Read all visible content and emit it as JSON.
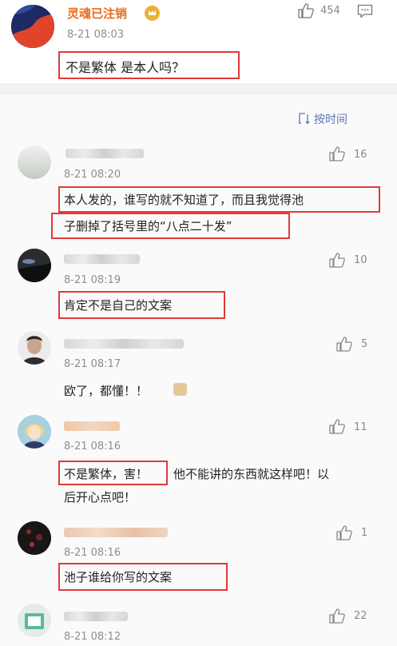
{
  "top": {
    "username": "灵魂已注销",
    "time": "8-21 08:03",
    "likes": "454",
    "text": "不是繁体 是本人吗？"
  },
  "sort_label": "按时间",
  "comments": [
    {
      "time": "8-21 08:20",
      "likes": "16",
      "line1": "本人发的，谁写的就不知道了，而且我觉得池",
      "line2": "子删掉了括号里的“八点二十发”"
    },
    {
      "time": "8-21 08:19",
      "likes": "10",
      "text": "肯定不是自己的文案"
    },
    {
      "time": "8-21 08:17",
      "likes": "5",
      "text": "欧了，都懂！！"
    },
    {
      "time": "8-21 08:16",
      "likes": "11",
      "boxed": "不是繁体，害！",
      "rest1": "他不能讲的东西就这样吧！以",
      "line2": "后开心点吧！"
    },
    {
      "time": "8-21 08:16",
      "likes": "1",
      "text": "池子谁给你写的文案"
    },
    {
      "time": "8-21 08:12",
      "likes": "22"
    }
  ],
  "colors": {
    "highlight": "#e03a3a",
    "username": "#e86c1c",
    "background": "#f2f2f2"
  },
  "icons": [
    "thumbs-up-icon",
    "comment-icon",
    "sort-icon",
    "vip-crown-icon",
    "emoji-icon"
  ]
}
